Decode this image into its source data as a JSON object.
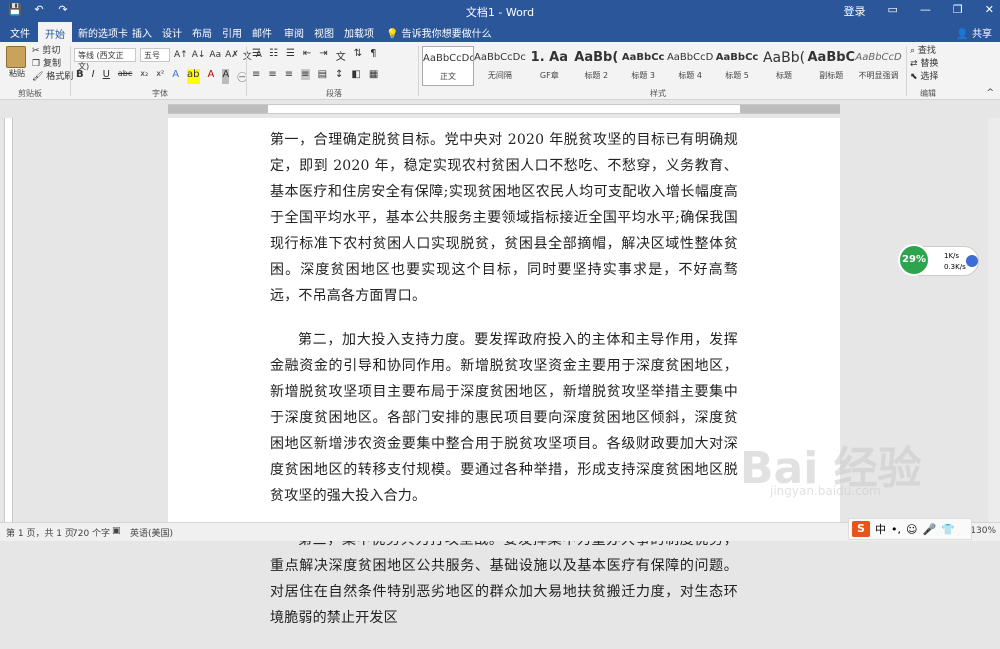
{
  "window": {
    "title": "文档1 - Word",
    "login": "登录",
    "share": "共享",
    "qat": {
      "save": "💾",
      "undo": "↶",
      "redo": "↷"
    }
  },
  "tabs": [
    "文件",
    "开始",
    "新的选项卡",
    "插入",
    "设计",
    "布局",
    "引用",
    "邮件",
    "审阅",
    "视图",
    "加载项"
  ],
  "active_tab": "开始",
  "tell_me": "告诉我你想要做什么",
  "ribbon": {
    "clipboard": {
      "paste": "粘贴",
      "cut": "剪切",
      "copy": "复制",
      "format_painter": "格式刷",
      "label": "剪贴板"
    },
    "font": {
      "name": "等线 (西文正文)",
      "size": "五号",
      "label": "字体"
    },
    "paragraph": {
      "label": "段落"
    },
    "styles": {
      "label": "样式",
      "items": [
        {
          "preview": "AaBbCcDc",
          "name": "正文"
        },
        {
          "preview": "AaBbCcDc",
          "name": "无间隔"
        },
        {
          "preview": "1. Aa",
          "name": "GF章"
        },
        {
          "preview": "AaBb(",
          "name": "标题 2"
        },
        {
          "preview": "AaBbCc",
          "name": "标题 3"
        },
        {
          "preview": "AaBbCcD",
          "name": "标题 4"
        },
        {
          "preview": "AaBbCc",
          "name": "标题 5"
        },
        {
          "preview": "AaBb(",
          "name": "标题"
        },
        {
          "preview": "AaBbC",
          "name": "副标题"
        },
        {
          "preview": "AaBbCcD",
          "name": "不明显强调"
        }
      ]
    },
    "editing": {
      "find": "查找",
      "replace": "替换",
      "select": "选择",
      "label": "编辑"
    }
  },
  "document": {
    "paragraphs": [
      "第一，合理确定脱贫目标。党中央对 2020 年脱贫攻坚的目标已有明确规定，即到 2020 年，稳定实现农村贫困人口不愁吃、不愁穿，义务教育、基本医疗和住房安全有保障;实现贫困地区农民人均可支配收入增长幅度高于全国平均水平，基本公共服务主要领域指标接近全国平均水平;确保我国现行标准下农村贫困人口实现脱贫，贫困县全部摘帽，解决区域性整体贫困。深度贫困地区也要实现这个目标，同时要坚持实事求是，不好高骛远，不吊高各方面胃口。",
      "第二，加大投入支持力度。要发挥政府投入的主体和主导作用，发挥金融资金的引导和协同作用。新增脱贫攻坚资金主要用于深度贫困地区，新增脱贫攻坚项目主要布局于深度贫困地区，新增脱贫攻坚举措主要集中于深度贫困地区。各部门安排的惠民项目要向深度贫困地区倾斜，深度贫困地区新增涉农资金要集中整合用于脱贫攻坚项目。各级财政要加大对深度贫困地区的转移支付规模。要通过各种举措，形成支持深度贫困地区脱贫攻坚的强大投入合力。",
      "第三，集中优势兵力打攻坚战。要发挥集中力量办大事的制度优势，重点解决深度贫困地区公共服务、基础设施以及基本医疗有保障的问题。对居住在自然条件特别恶劣地区的群众加大易地扶贫搬迁力度，对生态环境脆弱的禁止开发区"
    ]
  },
  "status": {
    "page": "第 1 页，共 1 页",
    "words": "720 个字",
    "language": "英语(美国)",
    "zoom": "130%"
  },
  "net_widget": {
    "cpu": "29%",
    "up": "1K/s",
    "down": "0.3K/s"
  },
  "watermark": {
    "main": "Bai 经验",
    "sub": "jingyan.baidu.com"
  }
}
